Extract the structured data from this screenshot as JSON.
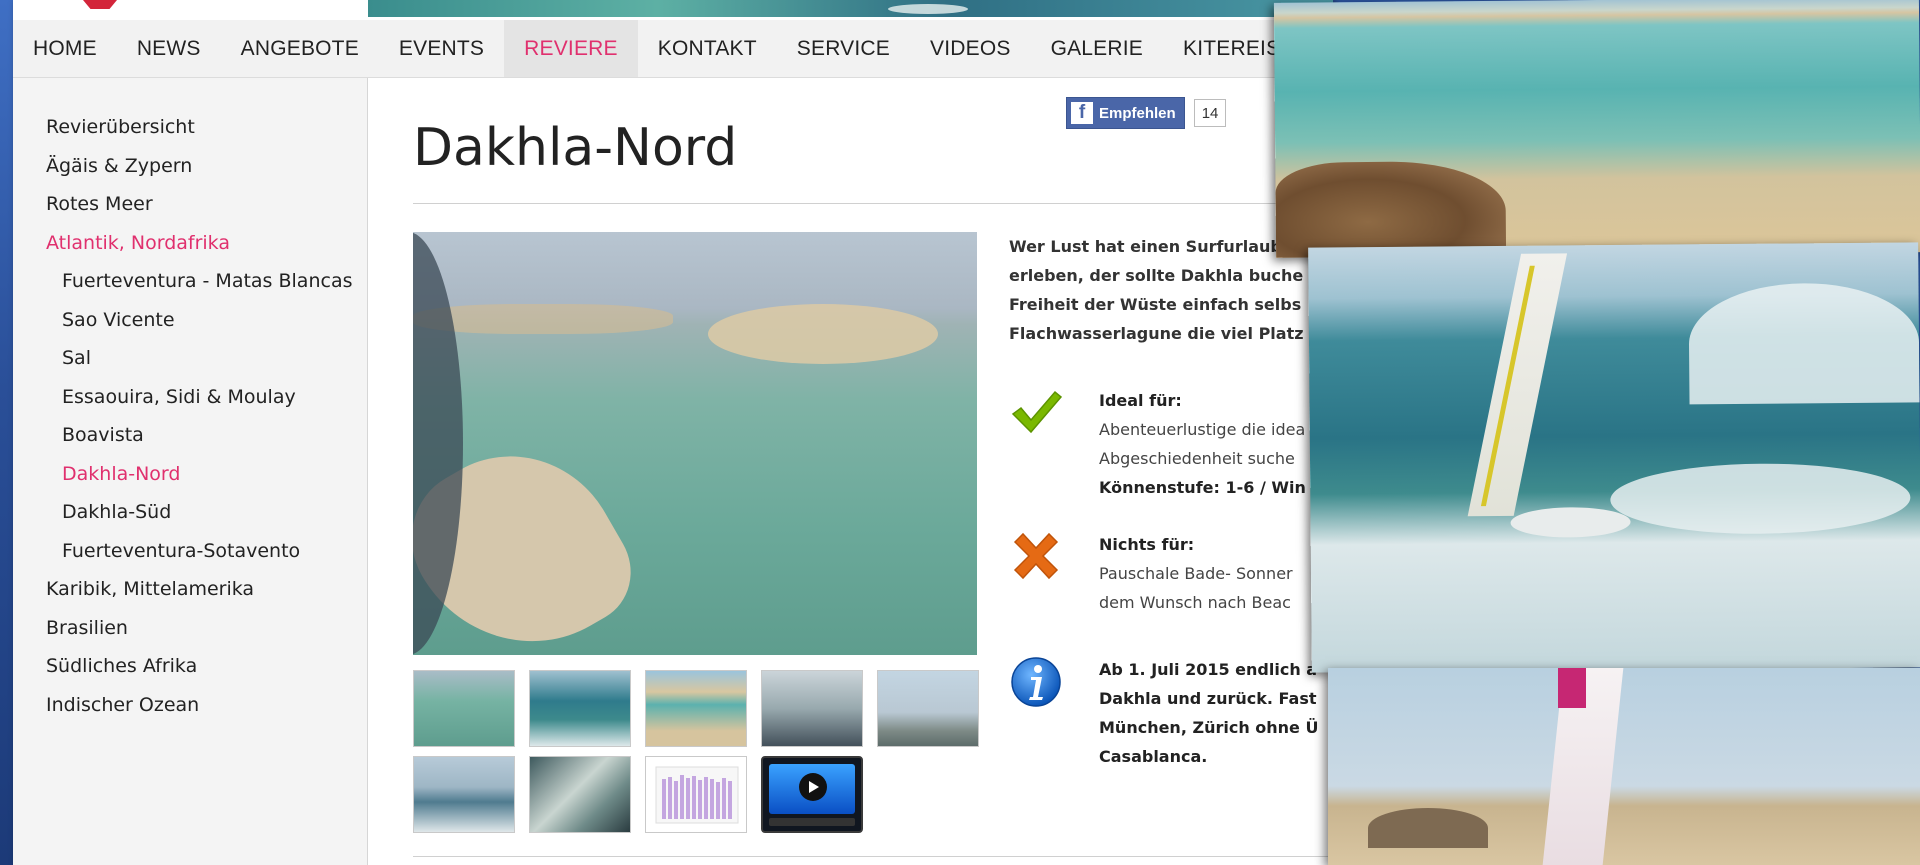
{
  "nav": {
    "items": [
      "HOME",
      "NEWS",
      "ANGEBOTE",
      "EVENTS",
      "REVIERE",
      "KONTAKT",
      "SERVICE",
      "VIDEOS",
      "GALERIE",
      "KITEREISEN"
    ],
    "active": "REVIERE"
  },
  "sidebar": {
    "items": [
      {
        "label": "Revierübersicht",
        "level": 0
      },
      {
        "label": "Ägäis & Zypern",
        "level": 0
      },
      {
        "label": "Rotes Meer",
        "level": 0
      },
      {
        "label": "Atlantik, Nordafrika",
        "level": 0,
        "active": true
      },
      {
        "label": "Fuerteventura - Matas Blancas",
        "level": 1
      },
      {
        "label": "Sao Vicente",
        "level": 1
      },
      {
        "label": "Sal",
        "level": 1
      },
      {
        "label": "Essaouira, Sidi & Moulay",
        "level": 1
      },
      {
        "label": "Boavista",
        "level": 1
      },
      {
        "label": "Dakhla-Nord",
        "level": 1,
        "active": true
      },
      {
        "label": "Dakhla-Süd",
        "level": 1
      },
      {
        "label": "Fuerteventura-Sotavento",
        "level": 1
      },
      {
        "label": "Karibik, Mittelamerika",
        "level": 0
      },
      {
        "label": "Brasilien",
        "level": 0
      },
      {
        "label": "Südliches Afrika",
        "level": 0
      },
      {
        "label": "Indischer Ozean",
        "level": 0
      }
    ]
  },
  "facebook": {
    "label": "Empfehlen",
    "count": "14"
  },
  "page": {
    "title": "Dakhla-Nord",
    "intro": "Wer Lust hat einen Surfurlaub\nerleben, der sollte Dakhla buche\nFreiheit der Wüste einfach selbs\nFlachwasserlagune die viel Platz"
  },
  "features": {
    "ideal": {
      "heading": "Ideal für:",
      "line1": "Abenteuerlustige die idea",
      "line2": "Abgeschiedenheit suche",
      "line3": "Könnenstufe: 1-6 / Win"
    },
    "nichts": {
      "heading": "Nichts für:",
      "line1": "Pauschale Bade- Sonner",
      "line2": "dem Wunsch nach Beac"
    },
    "info": {
      "line1": "Ab 1. Juli 2015 endlich a",
      "line2": "Dakhla und zurück. Fast",
      "line3": "München, Zürich ohne Ü",
      "line4": "Casablanca."
    }
  },
  "colors": {
    "accent": "#e0306e",
    "facebook": "#4a66a8",
    "check": "#7ab800",
    "cross": "#e56a14",
    "info": "#1a6fd0"
  },
  "icons": {
    "ideal": "checkmark-icon",
    "nichts": "cross-icon",
    "info": "info-icon",
    "video": "play-icon"
  }
}
